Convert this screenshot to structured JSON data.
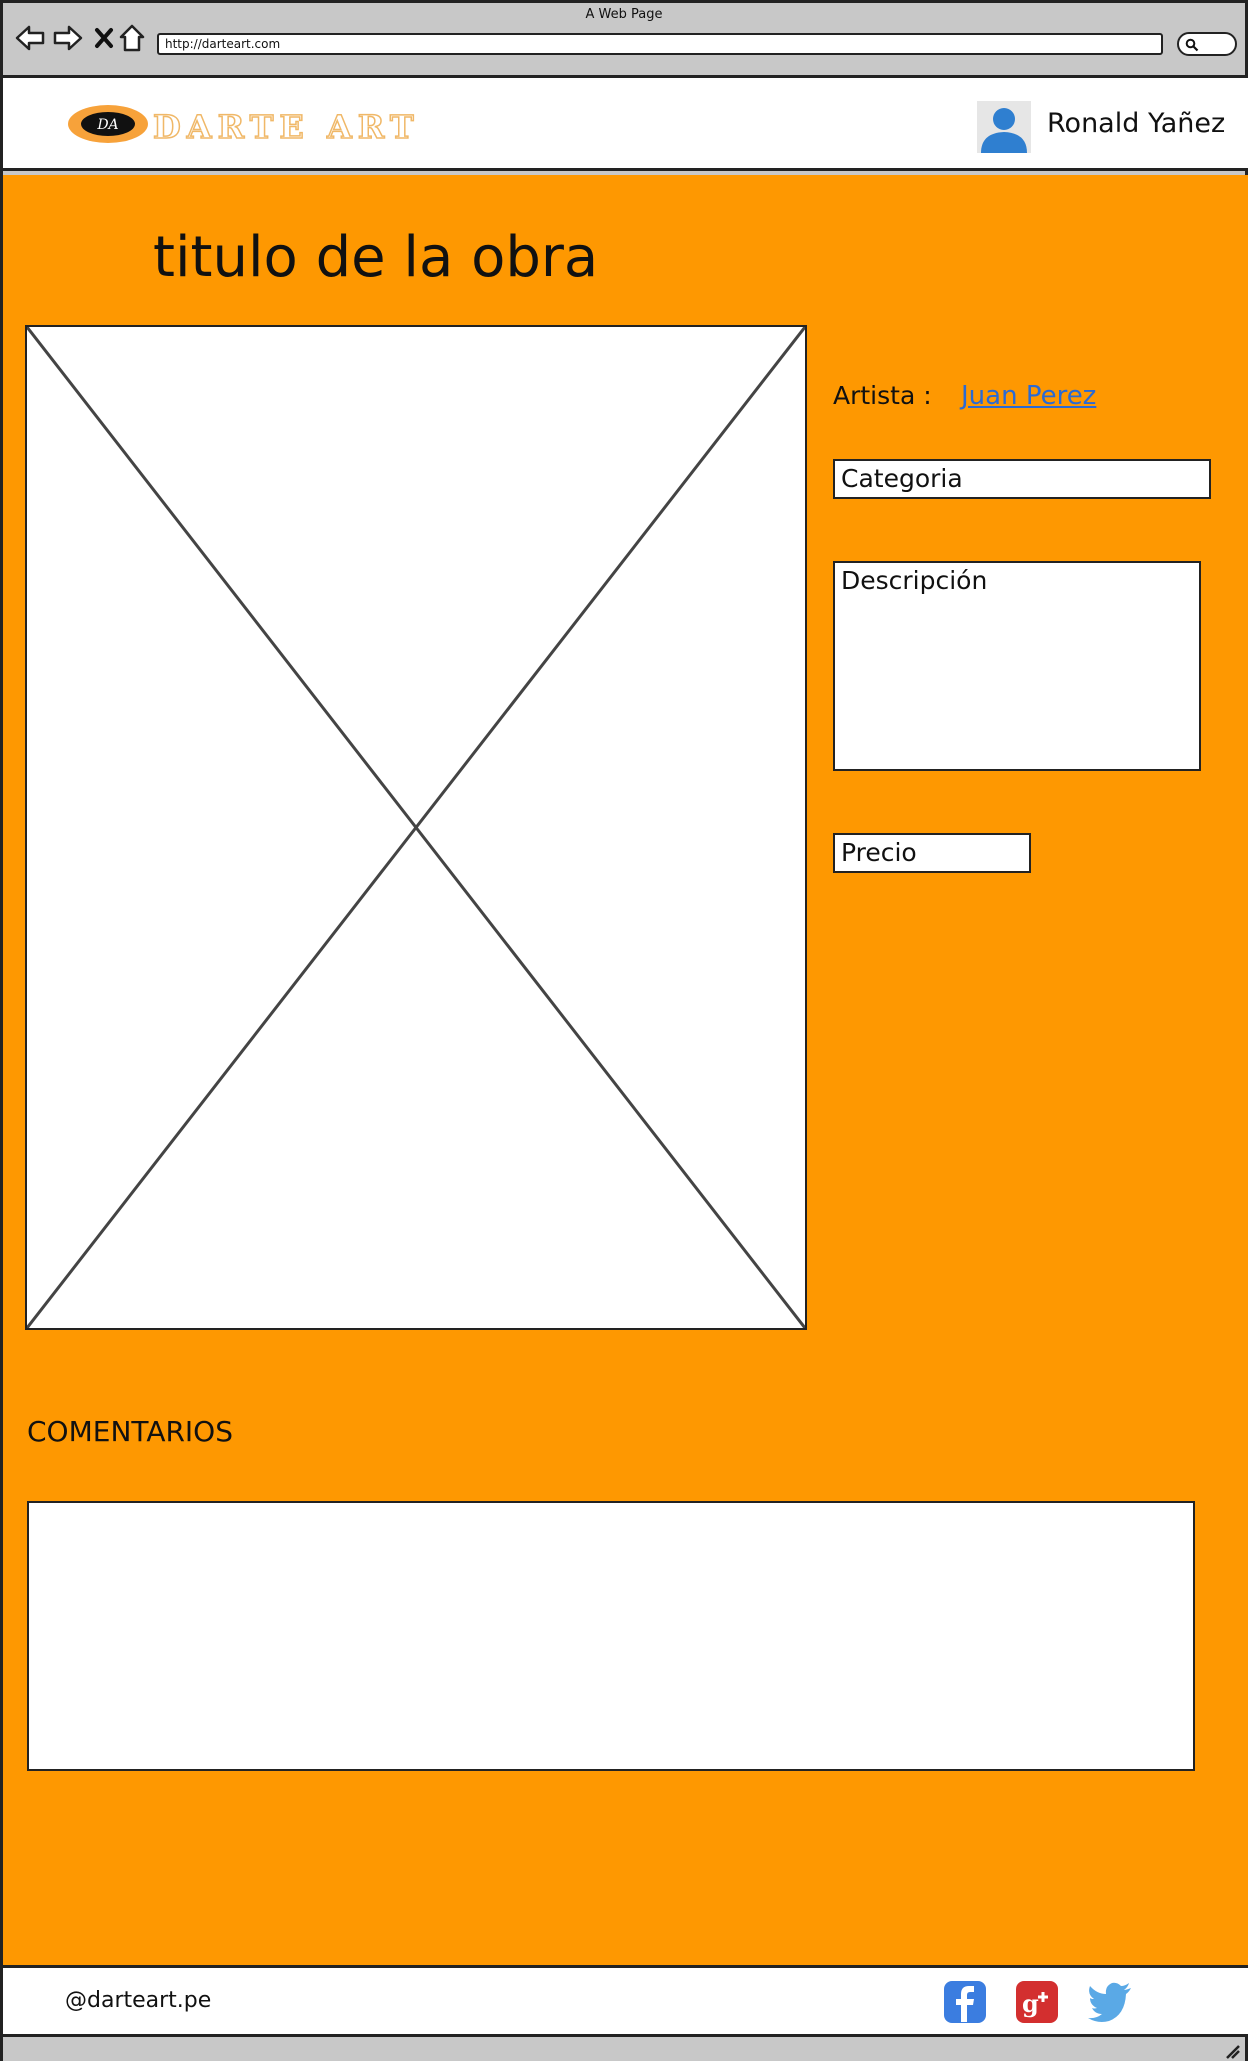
{
  "window": {
    "title": "A Web Page",
    "url": "http://darteart.com"
  },
  "header": {
    "brand": "DARTE ART",
    "logo_text": "DA",
    "user_name": "Ronald Yañez"
  },
  "artwork": {
    "title": "titulo de la obra",
    "artist_label": "Artista :",
    "artist_name": "Juan Perez",
    "category_label": "Categoria",
    "description_label": "Descripción",
    "price_label": "Precio"
  },
  "comments": {
    "heading": "COMENTARIOS"
  },
  "footer": {
    "handle": "@darteart.pe"
  },
  "colors": {
    "page_bg": "#fe9801",
    "link": "#2a6ad4",
    "facebook": "#3b7de0",
    "google_plus": "#d32f2f",
    "twitter": "#5aa9e6"
  },
  "icons": [
    "back-icon",
    "forward-icon",
    "stop-icon",
    "home-icon",
    "search-icon",
    "user-avatar-icon",
    "facebook-icon",
    "google-plus-icon",
    "twitter-icon",
    "resize-grip-icon"
  ]
}
